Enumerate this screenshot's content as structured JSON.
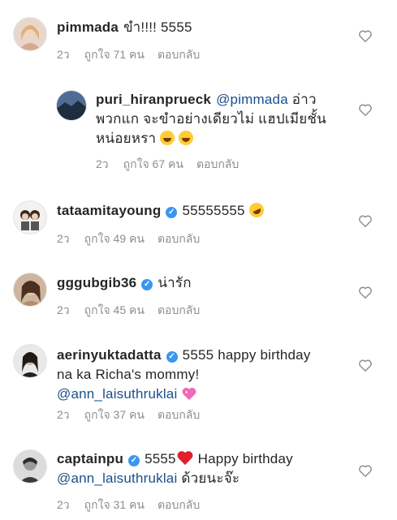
{
  "comments": [
    {
      "username": "pimmada",
      "text": "ขำ!!!! 5555",
      "time": "2ว",
      "likes": "ถูกใจ 71 คน",
      "reply": "ตอบกลับ"
    },
    {
      "username": "puri_hiranprueck",
      "mention": "@pimmada",
      "text1": "อ่าว",
      "text2": "พวกแก จะขำอย่างเดียวไม่ แฮปเมียชั้น",
      "text3": "หน่อยหรา",
      "time": "2ว",
      "likes": "ถูกใจ 67 คน",
      "reply": "ตอบกลับ"
    },
    {
      "username": "tataamitayoung",
      "text": "55555555",
      "time": "2ว",
      "likes": "ถูกใจ 49 คน",
      "reply": "ตอบกลับ"
    },
    {
      "username": "gggubgib36",
      "text": "น่ารัก",
      "time": "2ว",
      "likes": "ถูกใจ 45 คน",
      "reply": "ตอบกลับ"
    },
    {
      "username": "aerinyuktadatta",
      "text1": "5555 happy birthday",
      "text2": "na ka Richa's mommy!",
      "mention": "@ann_laisuthruklai",
      "time": "2ว",
      "likes": "ถูกใจ 37 คน",
      "reply": "ตอบกลับ"
    },
    {
      "username": "captainpu",
      "text1": "5555",
      "text2": "Happy birthday",
      "mention": "@ann_laisuthruklai",
      "text3": "ด้วยนะจ๊ะ",
      "time": "2ว",
      "likes": "ถูกใจ 31 คน",
      "reply": "ตอบกลับ"
    }
  ],
  "icons": {
    "heart": "heart-outline-icon",
    "verified": "verified-badge-icon"
  },
  "colors": {
    "text": "#262626",
    "meta": "#8e8e8e",
    "mention": "#1a4f8b",
    "verified": "#3897f0"
  }
}
